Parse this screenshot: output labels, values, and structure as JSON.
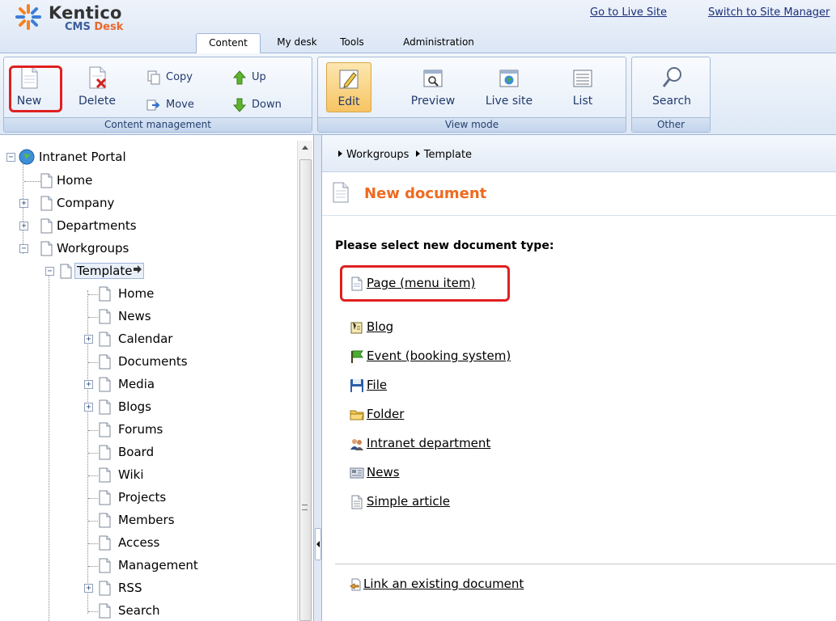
{
  "header": {
    "brand": "Kentico",
    "product_main": "CMS",
    "product_desk": "Desk",
    "links": {
      "live_site": "Go to Live Site",
      "site_manager": "Switch to Site Manager"
    },
    "tabs": [
      "Content",
      "My desk",
      "Tools",
      "Administration"
    ],
    "active_tab": "Content"
  },
  "ribbon": {
    "content_management": {
      "label": "Content management",
      "new": "New",
      "delete": "Delete",
      "copy": "Copy",
      "move": "Move",
      "up": "Up",
      "down": "Down"
    },
    "view_mode": {
      "label": "View mode",
      "edit": "Edit",
      "preview": "Preview",
      "live_site": "Live site",
      "list": "List",
      "active": "Edit"
    },
    "other": {
      "label": "Other",
      "search": "Search"
    }
  },
  "tree": {
    "root": "Intranet Portal",
    "top_items": [
      "Home",
      "Company",
      "Departments",
      "Workgroups"
    ],
    "selected": "Template",
    "template_children": [
      "Home",
      "News",
      "Calendar",
      "Documents",
      "Media",
      "Blogs",
      "Forums",
      "Board",
      "Wiki",
      "Projects",
      "Members",
      "Access",
      "Management",
      "RSS",
      "Search"
    ]
  },
  "breadcrumb": [
    "Workgroups",
    "Template"
  ],
  "page": {
    "title": "New document",
    "prompt": "Please select new document type:",
    "document_types": [
      {
        "label": "Page (menu item)",
        "icon": "page-icon"
      },
      {
        "label": "Blog",
        "icon": "blog-icon"
      },
      {
        "label": "Event (booking system)",
        "icon": "event-flag-icon"
      },
      {
        "label": "File",
        "icon": "floppy-disk-icon"
      },
      {
        "label": "Folder",
        "icon": "folder-icon"
      },
      {
        "label": "Intranet department",
        "icon": "people-icon"
      },
      {
        "label": "News",
        "icon": "newspaper-icon"
      },
      {
        "label": "Simple article",
        "icon": "article-icon"
      }
    ],
    "link_existing": "Link an existing document"
  },
  "colors": {
    "accent": "#ee6a1f",
    "highlight": "#e02020",
    "link": "#1b2f7a"
  }
}
